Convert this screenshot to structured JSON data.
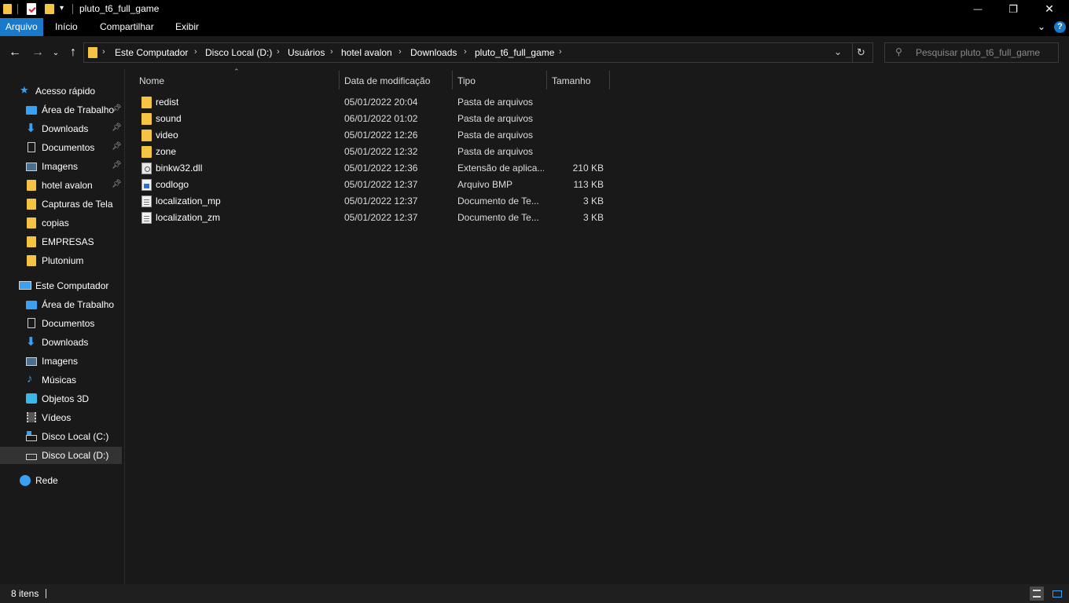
{
  "window": {
    "title": "pluto_t6_full_game",
    "controls": {
      "minimize": "—",
      "maximize": "❐",
      "close": "✕"
    }
  },
  "ribbon": {
    "tabs": [
      "Arquivo",
      "Início",
      "Compartilhar",
      "Exibir"
    ],
    "active_tab": "Arquivo",
    "help_label": "?"
  },
  "navigation": {
    "breadcrumbs": [
      "Este Computador",
      "Disco Local (D:)",
      "Usuários",
      "hotel avalon",
      "Downloads",
      "pluto_t6_full_game"
    ],
    "search_placeholder": "Pesquisar pluto_t6_full_game"
  },
  "sidebar": {
    "quick_access": {
      "label": "Acesso rápido",
      "items": [
        {
          "label": "Área de Trabalho",
          "icon": "desktop-icon",
          "pinned": true
        },
        {
          "label": "Downloads",
          "icon": "download-icon",
          "pinned": true
        },
        {
          "label": "Documentos",
          "icon": "document-icon",
          "pinned": true
        },
        {
          "label": "Imagens",
          "icon": "pictures-icon",
          "pinned": true
        },
        {
          "label": "hotel avalon",
          "icon": "folder-icon",
          "pinned": true
        },
        {
          "label": "Capturas de Tela",
          "icon": "folder-icon",
          "pinned": false
        },
        {
          "label": "copias",
          "icon": "folder-icon",
          "pinned": false
        },
        {
          "label": "EMPRESAS",
          "icon": "folder-icon",
          "pinned": false
        },
        {
          "label": "Plutonium",
          "icon": "folder-icon",
          "pinned": false
        }
      ]
    },
    "this_pc": {
      "label": "Este Computador",
      "items": [
        {
          "label": "Área de Trabalho",
          "icon": "desktop-icon"
        },
        {
          "label": "Documentos",
          "icon": "document-icon"
        },
        {
          "label": "Downloads",
          "icon": "download-icon"
        },
        {
          "label": "Imagens",
          "icon": "pictures-icon"
        },
        {
          "label": "Músicas",
          "icon": "music-icon"
        },
        {
          "label": "Objetos 3D",
          "icon": "3d-objects-icon"
        },
        {
          "label": "Vídeos",
          "icon": "videos-icon"
        },
        {
          "label": "Disco Local (C:)",
          "icon": "windows-drive-icon"
        },
        {
          "label": "Disco Local (D:)",
          "icon": "drive-icon",
          "selected": true
        }
      ]
    },
    "network": {
      "label": "Rede",
      "icon": "network-icon"
    }
  },
  "filelist": {
    "columns": [
      "Nome",
      "Data de modificação",
      "Tipo",
      "Tamanho"
    ],
    "rows": [
      {
        "name": "redist",
        "modified": "05/01/2022 20:04",
        "type": "Pasta de arquivos",
        "size": "",
        "icon": "folder-icon"
      },
      {
        "name": "sound",
        "modified": "06/01/2022 01:02",
        "type": "Pasta de arquivos",
        "size": "",
        "icon": "folder-icon"
      },
      {
        "name": "video",
        "modified": "05/01/2022 12:26",
        "type": "Pasta de arquivos",
        "size": "",
        "icon": "folder-icon"
      },
      {
        "name": "zone",
        "modified": "05/01/2022 12:32",
        "type": "Pasta de arquivos",
        "size": "",
        "icon": "folder-icon"
      },
      {
        "name": "binkw32.dll",
        "modified": "05/01/2022 12:36",
        "type": "Extensão de aplica...",
        "size": "210 KB",
        "icon": "dll-file-icon"
      },
      {
        "name": "codlogo",
        "modified": "05/01/2022 12:37",
        "type": "Arquivo BMP",
        "size": "113 KB",
        "icon": "bmp-file-icon"
      },
      {
        "name": "localization_mp",
        "modified": "05/01/2022 12:37",
        "type": "Documento de Te...",
        "size": "3 KB",
        "icon": "text-file-icon"
      },
      {
        "name": "localization_zm",
        "modified": "05/01/2022 12:37",
        "type": "Documento de Te...",
        "size": "3 KB",
        "icon": "text-file-icon"
      }
    ]
  },
  "status": {
    "item_count": "8 itens"
  }
}
